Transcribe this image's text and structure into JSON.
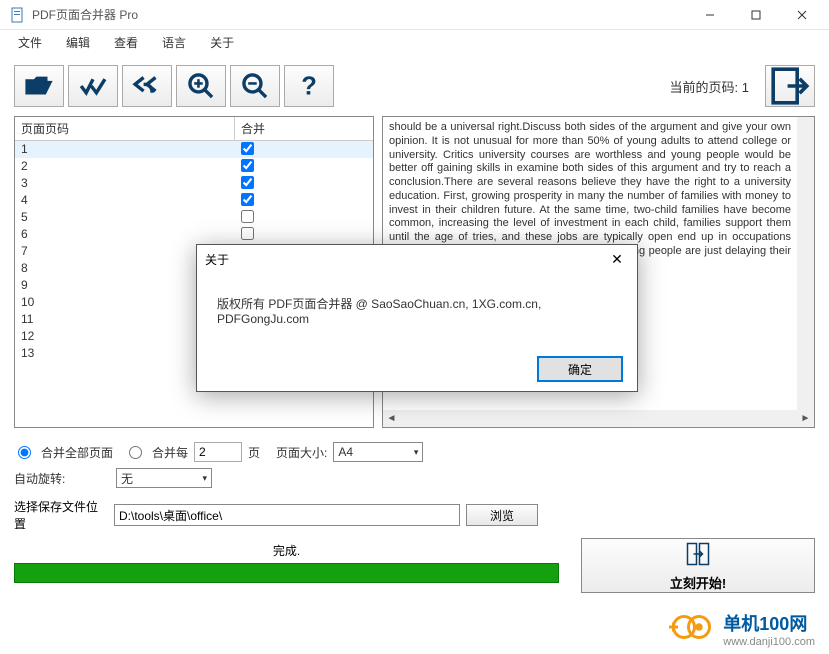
{
  "window": {
    "title": "PDF页面合并器 Pro"
  },
  "menu": {
    "file": "文件",
    "edit": "编辑",
    "view": "查看",
    "lang": "语言",
    "about": "关于"
  },
  "toolbar": {
    "page_indicator": "当前的页码: 1"
  },
  "table": {
    "col_page": "页面页码",
    "col_merge": "合并",
    "rows": [
      {
        "n": "1",
        "c": true
      },
      {
        "n": "2",
        "c": true
      },
      {
        "n": "3",
        "c": true
      },
      {
        "n": "4",
        "c": true
      },
      {
        "n": "5",
        "c": false
      },
      {
        "n": "6",
        "c": false
      },
      {
        "n": "7",
        "c": false
      },
      {
        "n": "8",
        "c": false
      },
      {
        "n": "9",
        "c": false
      },
      {
        "n": "10",
        "c": false
      },
      {
        "n": "11",
        "c": false
      },
      {
        "n": "12",
        "c": false
      },
      {
        "n": "13",
        "c": false
      }
    ]
  },
  "preview": {
    "text": "should be a universal right.Discuss both sides of the argument and give your own opinion. It is not unusual for more than 50% of young adults to attend college or university. Critics university courses are worthless and young people would be better off gaining skills in examine both sides of this argument and try to reach a conclusion.There are several reasons believe they have the right to a university education. First, growing prosperity in many the number of families with money to invest in their children   future. At the same time, two-child families have become common, increasing the level of investment in each child,                                                                                                         families support them until the age of                                                                                                           tries, and these jobs are typically open                                                                                                          end up in occupations unrelated to                                                                                                          working in sales, or an engineering                                                                                                         ung people are just delaying their entry                                                              €?              €          €?\n\n\n                                                                                                                   €?\n\n                                       €?"
  },
  "options": {
    "merge_all": "合并全部页面",
    "merge_every": "合并每",
    "every_value": "2",
    "pages_suffix": "页",
    "page_size_label": "页面大小:",
    "page_size_value": "A4",
    "auto_rotate_label": "自动旋转:",
    "auto_rotate_value": "无",
    "save_loc_label": "选择保存文件位置",
    "save_path": "D:\\tools\\桌面\\office\\",
    "browse": "浏览"
  },
  "status": {
    "done": "完成."
  },
  "actions": {
    "start": "立刻开始!"
  },
  "modal": {
    "title": "关于",
    "body": "版权所有 PDF页面合并器 @ SaoSaoChuan.cn, 1XG.com.cn, PDFGongJu.com",
    "ok": "确定"
  },
  "watermark": {
    "name": "单机100网",
    "url": "www.danji100.com"
  }
}
